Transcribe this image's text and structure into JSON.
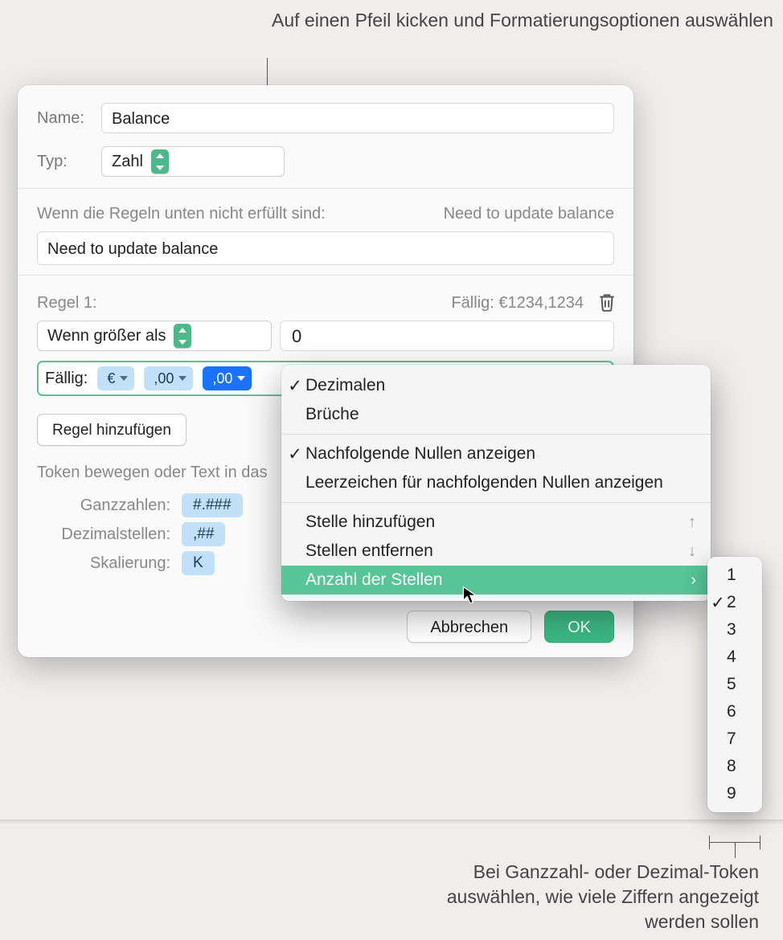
{
  "callouts": {
    "top": "Auf einen Pfeil kicken und Formatierungsoptionen auswählen",
    "bottom": "Bei Ganzzahl- oder Dezimal-Token auswählen, wie viele Ziffern angezeigt werden sollen"
  },
  "form": {
    "name_label": "Name:",
    "name_value": "Balance",
    "type_label": "Typ:",
    "type_value": "Zahl",
    "fallback_label": "Wenn die Regeln unten nicht erfüllt sind:",
    "fallback_preview": "Need to update balance",
    "fallback_input": "Need to update balance"
  },
  "rule": {
    "header_label": "Regel 1:",
    "header_preview": "Fällig: €1234,1234",
    "condition": "Wenn größer als",
    "value": "0",
    "prefix": "Fällig:",
    "token_currency": "€",
    "token_dec1": ",00",
    "token_dec2": ",00"
  },
  "add_rule_label": "Regel hinzufügen",
  "hint_text": "Token bewegen oder Text in das",
  "tokens_table": {
    "row1_label": "Ganzzahlen:",
    "row1_value": "#.###",
    "row2_label": "Dezimalstellen:",
    "row2_value": ",##",
    "row3_label": "Skalierung:",
    "row3_value": "K"
  },
  "buttons": {
    "cancel": "Abbrechen",
    "ok": "OK"
  },
  "menu": {
    "decimals": "Dezimalen",
    "fractions": "Brüche",
    "trailing_zeros": "Nachfolgende Nullen anzeigen",
    "trailing_spaces": "Leerzeichen für nachfolgenden Nullen anzeigen",
    "add_place": "Stelle hinzufügen",
    "remove_place": "Stellen entfernen",
    "num_places": "Anzahl der Stellen"
  },
  "submenu": {
    "values": [
      "1",
      "2",
      "3",
      "4",
      "5",
      "6",
      "7",
      "8",
      "9"
    ],
    "selected_index": 1
  }
}
